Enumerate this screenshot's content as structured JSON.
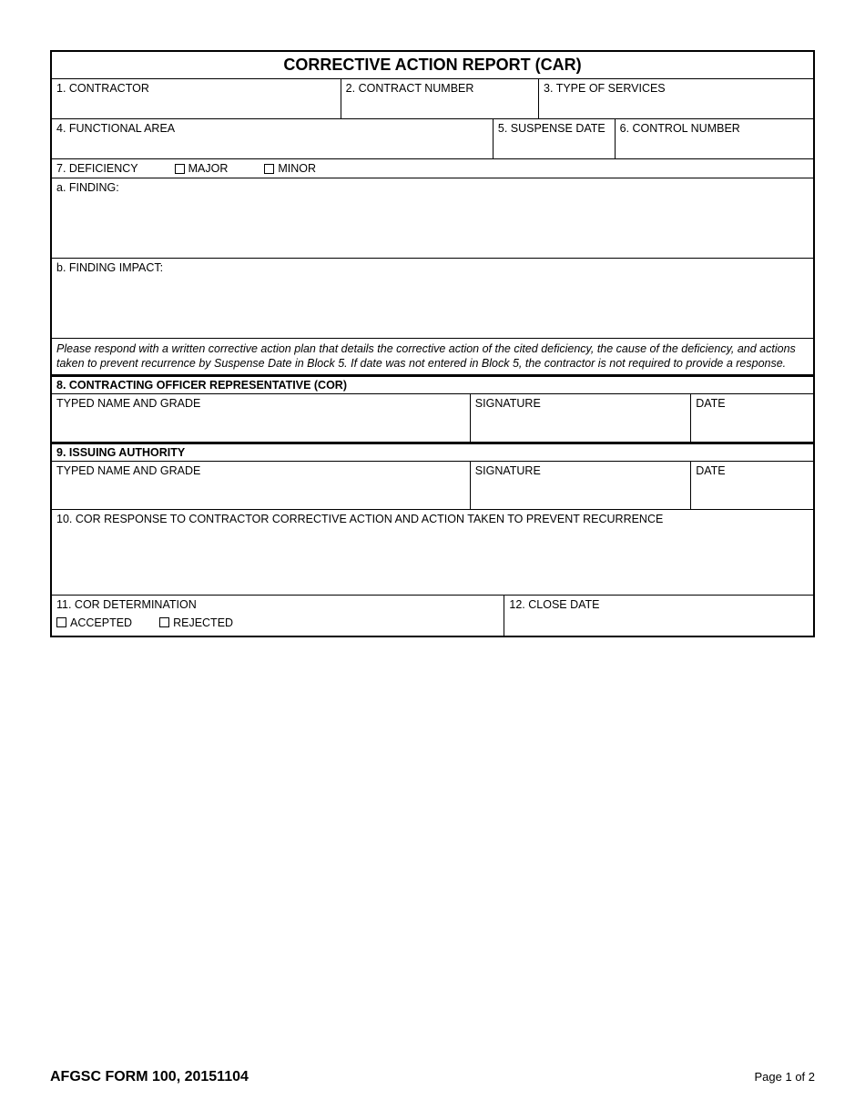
{
  "title": "CORRECTIVE ACTION REPORT (CAR)",
  "fields": {
    "f1": "1. CONTRACTOR",
    "f2": "2. CONTRACT NUMBER",
    "f3": "3.  TYPE OF SERVICES",
    "f4": "4. FUNCTIONAL AREA",
    "f5": "5. SUSPENSE DATE",
    "f6": "6. CONTROL NUMBER",
    "f7": "7. DEFICIENCY",
    "major": "MAJOR",
    "minor": "MINOR",
    "f7a": "a. FINDING:",
    "f7b": "b. FINDING IMPACT:",
    "instruction": "Please respond with a written corrective action plan that details the corrective action of the cited deficiency, the cause of the deficiency, and actions taken to prevent recurrence by Suspense Date in Block 5.  If date was not entered in Block 5, the contractor is not required to provide a response.",
    "f8": "8. CONTRACTING OFFICER REPRESENTATIVE (COR)",
    "typed": "TYPED NAME AND GRADE",
    "signature": "SIGNATURE",
    "date": "DATE",
    "f9": "9. ISSUING AUTHORITY",
    "f10": "10. COR RESPONSE TO CONTRACTOR CORRECTIVE ACTION AND ACTION TAKEN TO PREVENT RECURRENCE",
    "f11": "11. COR DETERMINATION",
    "accepted": "ACCEPTED",
    "rejected": "REJECTED",
    "f12": "12. CLOSE DATE"
  },
  "footer": {
    "formId": "AFGSC FORM 100, 20151104",
    "page": "Page 1 of 2"
  }
}
